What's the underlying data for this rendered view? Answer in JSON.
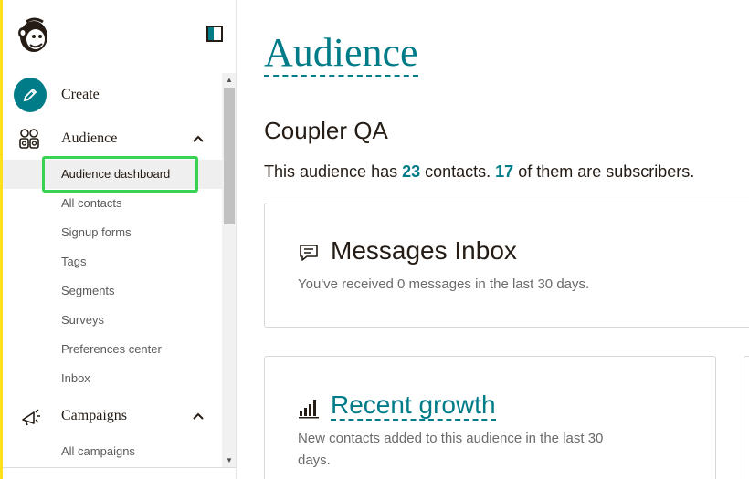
{
  "sidebar": {
    "collapse_tooltip": "",
    "main_items": [
      {
        "label": "Create",
        "icon": "pencil-icon"
      },
      {
        "label": "Audience",
        "icon": "audience-icon"
      },
      {
        "label": "Campaigns",
        "icon": "megaphone-icon"
      }
    ],
    "audience_subitems": [
      {
        "label": "Audience dashboard",
        "active": true
      },
      {
        "label": "All contacts"
      },
      {
        "label": "Signup forms"
      },
      {
        "label": "Tags"
      },
      {
        "label": "Segments"
      },
      {
        "label": "Surveys"
      },
      {
        "label": "Preferences center"
      },
      {
        "label": "Inbox"
      }
    ],
    "campaign_subitems": [
      {
        "label": "All campaigns"
      }
    ]
  },
  "main": {
    "title": "Audience",
    "audience_name": "Coupler QA",
    "summary": {
      "prefix": "This audience has ",
      "contacts_count": "23",
      "middle": " contacts. ",
      "subscribers_count": "17",
      "suffix": " of them are subscribers."
    },
    "inbox_card": {
      "title": "Messages Inbox",
      "description": "You've received 0 messages in the last 30 days.",
      "icon": "message-icon"
    },
    "growth_card": {
      "title": "Recent growth",
      "description_line1": "New contacts added to this audience in the last 30",
      "description_line2": "days.",
      "icon": "bar-chart-icon"
    }
  },
  "colors": {
    "accent": "#007c89",
    "brand_yellow": "#ffe01b",
    "highlight_green": "#39d353"
  }
}
